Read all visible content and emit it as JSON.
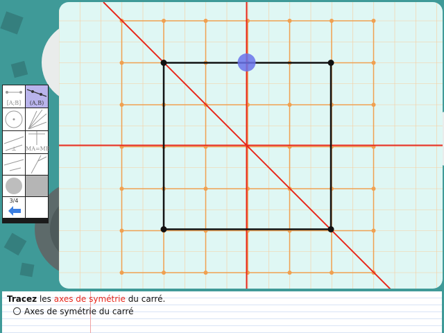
{
  "instruction": {
    "verb": "Tracez",
    "pre": " les ",
    "highlight": "axes de symétrie",
    "post": " du carré."
  },
  "task": {
    "label": "Axes de symétrie du carré"
  },
  "toolbox": {
    "tools": [
      {
        "name": "segment-tool",
        "label": "[A;B]"
      },
      {
        "name": "line-tool",
        "label": "(A,B)"
      },
      {
        "name": "circle-tool",
        "label": ""
      },
      {
        "name": "compass-tool",
        "label": ""
      },
      {
        "name": "perpendicular-tool",
        "label": "⊥"
      },
      {
        "name": "midpoint-tool",
        "label": "MA=MB"
      },
      {
        "name": "ruler-tool",
        "label": ""
      },
      {
        "name": "protractor-tool",
        "label": ""
      }
    ],
    "page_counter": "3/4"
  },
  "colors": {
    "grid": "#f0a050",
    "axis": "#e8271b",
    "square": "#111111",
    "cursor": "#6a73ea",
    "canvas_bg": "#dff7f4"
  }
}
